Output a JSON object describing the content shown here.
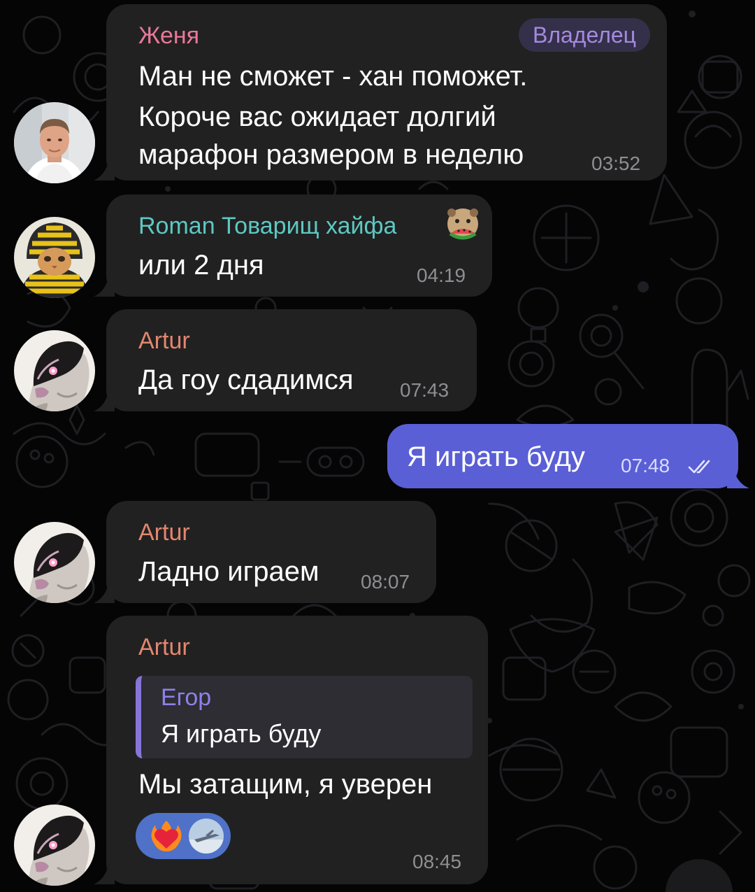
{
  "chat": {
    "messages": [
      {
        "id": 1,
        "direction": "incoming",
        "sender": "Женя",
        "sender_color": "#e9789b",
        "badge": "Владелец",
        "lines": [
          "Ман не сможет - хан поможет.",
          "Короче вас ожидает долгий",
          "марафон размером в неделю"
        ],
        "time": "03:52",
        "avatar": "man-photo-avatar"
      },
      {
        "id": 2,
        "direction": "incoming",
        "sender": "Roman Товарищ хайфа",
        "sender_color": "#5ec8c2",
        "sender_emoji": "otter-eating-watermelon-emoji",
        "lines": [
          "или 2 дня"
        ],
        "time": "04:19",
        "avatar": "cat-in-striped-hat-avatar"
      },
      {
        "id": 3,
        "direction": "incoming",
        "sender": "Artur",
        "sender_color": "#e3866f",
        "lines": [
          "Да гоу сдадимся"
        ],
        "time": "07:43",
        "avatar": "masked-statue-avatar"
      },
      {
        "id": 4,
        "direction": "outgoing",
        "lines": [
          "Я играть буду"
        ],
        "time": "07:48",
        "status": "read-double-check"
      },
      {
        "id": 5,
        "direction": "incoming",
        "sender": "Artur",
        "sender_color": "#e3866f",
        "lines": [
          "Ладно играем"
        ],
        "time": "08:07",
        "avatar": "masked-statue-avatar"
      },
      {
        "id": 6,
        "direction": "incoming",
        "sender": "Artur",
        "sender_color": "#e3866f",
        "reply": {
          "name": "Егор",
          "text": "Я играть буду",
          "accent_color": "#8875d8"
        },
        "lines": [
          "Мы затащим, я уверен"
        ],
        "reactions": [
          {
            "emoji": "heart-on-fire-emoji",
            "reactor": "reactor-avatar"
          }
        ],
        "time": "08:45",
        "avatar": "masked-statue-avatar"
      }
    ]
  },
  "colors": {
    "background": "#050505",
    "incoming_bubble": "#212121",
    "outgoing_bubble": "#5a5fd6",
    "time_text": "#8e8e93",
    "badge_bg": "#35304a",
    "badge_text": "#a48ae0",
    "reaction_bg": "#4f71c8"
  }
}
